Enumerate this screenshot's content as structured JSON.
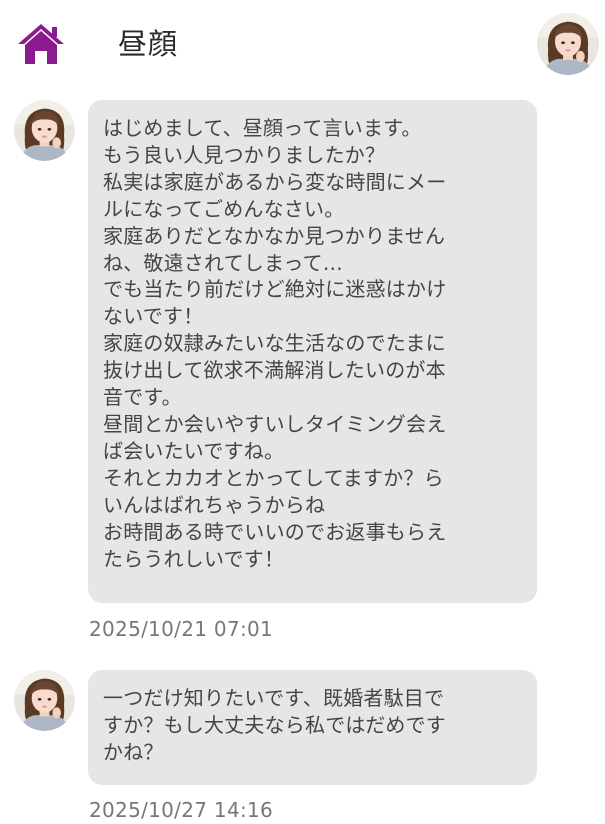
{
  "header": {
    "title": "昼顔",
    "home_icon": "home-icon",
    "accent_color": "#8b1a8f"
  },
  "messages": [
    {
      "text": "はじめまして、昼顔って言います。\nもう良い人見つかりましたか？\n私実は家庭があるから変な時間にメー\nルになってごめんなさい。\n家庭ありだとなかなか見つかりません\nね、敬遠されてしまって…\nでも当たり前だけど絶対に迷惑はかけ\nないです！\n家庭の奴隷みたいな生活なのでたまに\n抜け出して欲求不満解消したいのが本\n音です。\n昼間とか会いやすいしタイミング会え\nば会いたいですね。\nそれとカカオとかってしてますか？ら\nいんはばれちゃうからね\nお時間ある時でいいのでお返事もらえ\nたらうれしいです！",
      "timestamp": "2025/10/21 07:01"
    },
    {
      "text": "一つだけ知りたいです、既婚者駄目で\nすか？もし大丈夫なら私ではだめです\nかね？",
      "timestamp": "2025/10/27 14:16"
    }
  ],
  "colors": {
    "bubble": "#e6e6e6",
    "timestamp": "#777777"
  }
}
